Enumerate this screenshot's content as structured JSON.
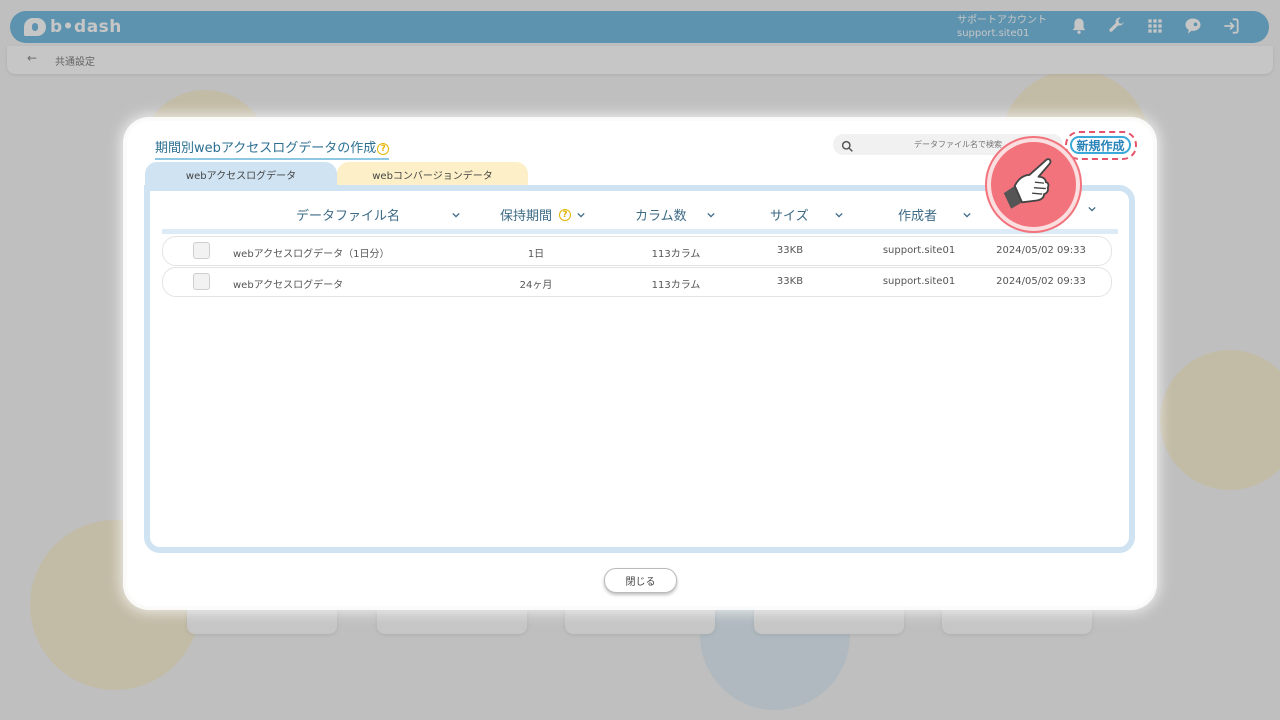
{
  "app": {
    "logo_text": "b•dash",
    "account_label": "サポートアカウント",
    "account_id": "support.site01",
    "brand_color": "#4aa7d6",
    "top_icons": [
      "bell-icon",
      "wrench-icon",
      "grid-icon",
      "chat-icon",
      "logout-icon"
    ]
  },
  "subheader": {
    "back_icon": "←",
    "breadcrumb": "共通設定"
  },
  "modal": {
    "title": "期間別webアクセスログデータの作成",
    "search_placeholder": "データファイル名で検索",
    "new_button": "新規作成",
    "close_button": "閉じる",
    "tabs": [
      {
        "label": "webアクセスログデータ",
        "active": true
      },
      {
        "label": "webコンバージョンデータ",
        "active": false
      }
    ],
    "columns": [
      {
        "label": "データファイル名"
      },
      {
        "label": "保持期間"
      },
      {
        "label": "カラム数"
      },
      {
        "label": "サイズ"
      },
      {
        "label": "作成者"
      },
      {
        "label": ""
      }
    ],
    "rows": [
      {
        "name": "webアクセスログデータ（1日分）",
        "period": "1日",
        "columns": "113カラム",
        "size": "33KB",
        "author": "support.site01",
        "date": "2024/05/02 09:33"
      },
      {
        "name": "webアクセスログデータ",
        "period": "24ヶ月",
        "columns": "113カラム",
        "size": "33KB",
        "author": "support.site01",
        "date": "2024/05/02 09:33"
      }
    ]
  }
}
